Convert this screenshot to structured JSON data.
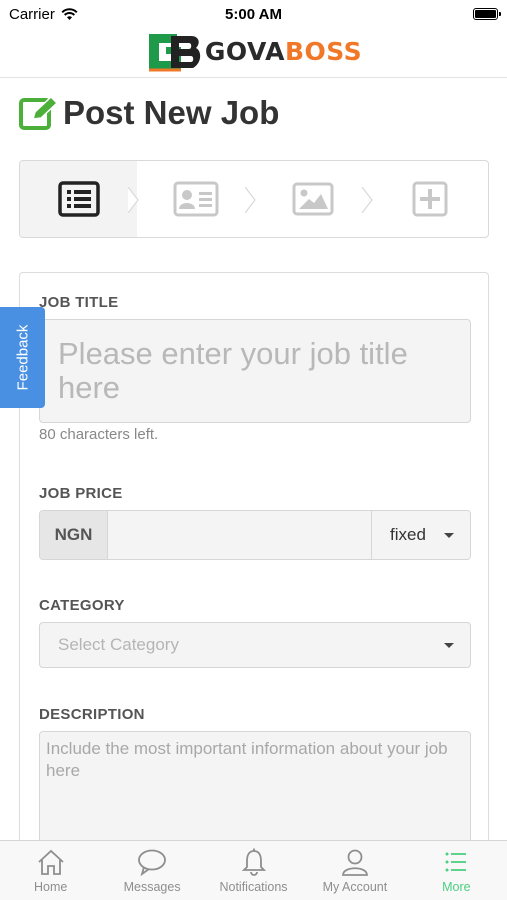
{
  "status_bar": {
    "carrier": "Carrier",
    "time": "5:00 AM"
  },
  "header": {
    "logo_mark": "GB",
    "logo_text_1": "GOVA",
    "logo_text_2": "BOSS",
    "brand_orange": "#f07828",
    "brand_green": "#1e9a4a"
  },
  "page": {
    "title": "Post New Job",
    "title_icon": "edit-icon"
  },
  "steps": [
    {
      "icon": "list-icon",
      "active": true
    },
    {
      "icon": "id-card-icon",
      "active": false
    },
    {
      "icon": "image-icon",
      "active": false
    },
    {
      "icon": "plus-square-icon",
      "active": false
    }
  ],
  "form": {
    "job_title": {
      "label": "JOB TITLE",
      "placeholder": "Please enter your job title here",
      "helper": "80 characters left."
    },
    "job_price": {
      "label": "JOB PRICE",
      "currency": "NGN",
      "value": "",
      "price_type": "fixed"
    },
    "category": {
      "label": "CATEGORY",
      "placeholder": "Select Category"
    },
    "description": {
      "label": "DESCRIPTION",
      "placeholder": "Include the most important information about your job here"
    }
  },
  "feedback": {
    "label": "Feedback",
    "color": "#4a90e2"
  },
  "tabbar": {
    "active_color": "#4cd080",
    "items": [
      {
        "label": "Home",
        "icon": "home-icon"
      },
      {
        "label": "Messages",
        "icon": "chat-icon"
      },
      {
        "label": "Notifications",
        "icon": "bell-icon"
      },
      {
        "label": "My Account",
        "icon": "user-icon"
      },
      {
        "label": "More",
        "icon": "menu-icon",
        "active": true
      }
    ]
  }
}
